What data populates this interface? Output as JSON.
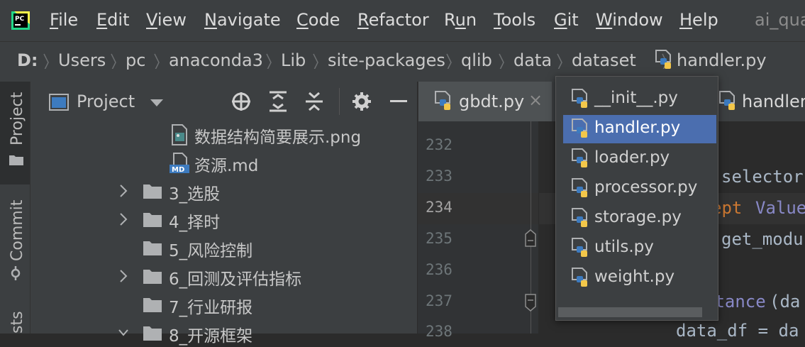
{
  "menubar": {
    "items": [
      {
        "key": "F",
        "rest": "ile"
      },
      {
        "key": "E",
        "rest": "dit"
      },
      {
        "key": "V",
        "rest": "iew"
      },
      {
        "key": "N",
        "rest": "avigate"
      },
      {
        "key": "C",
        "rest": "ode"
      },
      {
        "key": "R",
        "rest": "efactor"
      },
      {
        "pre": "R",
        "key": "u",
        "rest": "n"
      },
      {
        "key": "T",
        "rest": "ools"
      },
      {
        "key": "G",
        "rest": "it"
      },
      {
        "key": "W",
        "rest": "indow"
      },
      {
        "key": "H",
        "rest": "elp"
      }
    ],
    "project_title": "ai_qua",
    "logo_text": "PC"
  },
  "breadcrumb": [
    "D:",
    "Users",
    "pc",
    "anaconda3",
    "Lib",
    "site-packages",
    "qlib",
    "data",
    "dataset",
    "handler.py"
  ],
  "toolstrip": {
    "project": "Project",
    "commit": "Commit",
    "structure": "sts"
  },
  "project_panel": {
    "title": "Project",
    "tree": [
      {
        "label": "数据结构简要展示.png",
        "type": "png",
        "arrow": false
      },
      {
        "label": "资源.md",
        "type": "md",
        "arrow": false
      },
      {
        "label": "3_选股",
        "type": "folder",
        "arrow": true
      },
      {
        "label": "4_择时",
        "type": "folder",
        "arrow": true
      },
      {
        "label": "5_风险控制",
        "type": "folder",
        "arrow": false
      },
      {
        "label": "6_回测及评估指标",
        "type": "folder",
        "arrow": true
      },
      {
        "label": "7_行业研报",
        "type": "folder",
        "arrow": false
      },
      {
        "label": "8_开源框架",
        "type": "folder",
        "arrow": true
      }
    ],
    "md_badge": "MD"
  },
  "editor": {
    "tabs": [
      {
        "label": "gbdt.py",
        "close": "×"
      },
      {
        "label": "handler.py"
      }
    ],
    "line_numbers": [
      "232",
      "233",
      "234",
      "235",
      "236",
      "237",
      "238"
    ],
    "code_fragments": {
      "l233": "selector",
      "l234a": "ept",
      "l234b": "Value",
      "l235": "get_modu",
      "l237a": "stance",
      "l237b": "(da",
      "l238": "data_df = da"
    }
  },
  "popup": {
    "items": [
      "__init__.py",
      "handler.py",
      "loader.py",
      "processor.py",
      "storage.py",
      "utils.py",
      "weight.py"
    ],
    "selected_index": 1
  }
}
